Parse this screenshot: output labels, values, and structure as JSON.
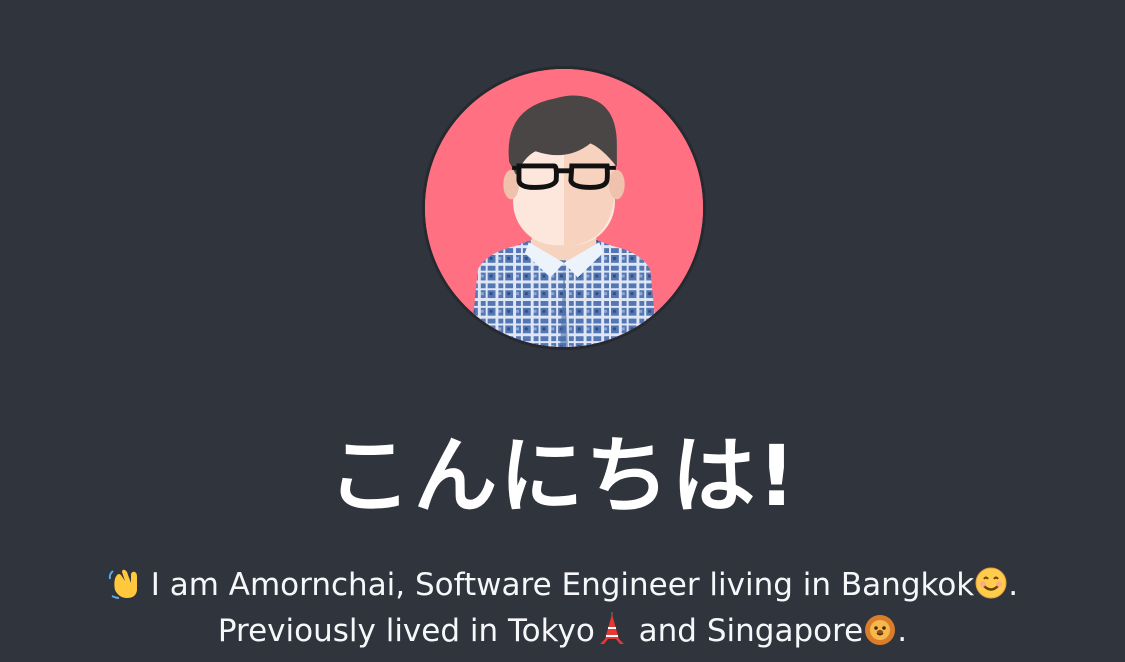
{
  "profile": {
    "avatar_icon": "person-with-glasses-avatar-icon",
    "avatar_background": "#ff7182"
  },
  "hero": {
    "greeting": "こんにちは!"
  },
  "bio": {
    "line1_prefix": "I am Amornchai, Software Engineer living in Bangkok",
    "line1_suffix": ".",
    "line2_prefix": "Previously lived in Tokyo",
    "line2_middle": " and Singapore",
    "line2_suffix": ".",
    "icons": {
      "wave": "waving-hand-icon",
      "smile": "smiling-face-icon",
      "tokyo": "tokyo-tower-icon",
      "singapore": "lion-face-icon"
    }
  },
  "colors": {
    "background": "#30353d",
    "text": "#ffffff",
    "accent": "#ff7182",
    "shirt": "#4c6fa8"
  }
}
